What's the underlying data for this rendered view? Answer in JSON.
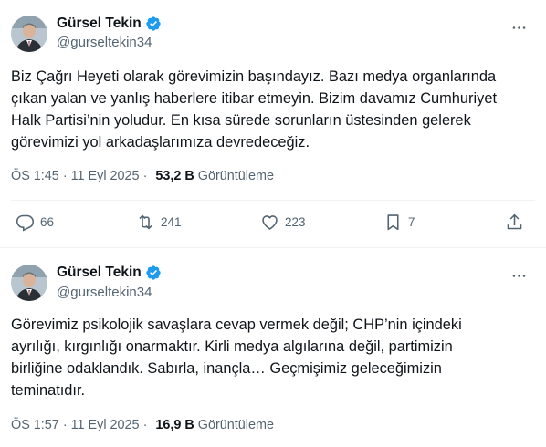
{
  "tweets": [
    {
      "author": {
        "name": "Gürsel Tekin",
        "handle": "@gurseltekin34"
      },
      "text": "Biz Çağrı Heyeti olarak görevimizin başındayız. Bazı medya organlarında\nçıkan yalan ve yanlış haberlere itibar etmeyin. Bizim davamız Cumhuriyet\nHalk Partisi’nin yoludur. En kısa sürede sorunların üstesinden gelerek\ngörevimizi yol arkadaşlarımıza devredeceğiz.",
      "time": "ÖS 1:45",
      "date": "11 Eyl 2025",
      "views_count": "53,2 B",
      "views_label": "Görüntüleme",
      "actions": {
        "replies": "66",
        "reposts": "241",
        "likes": "223",
        "bookmarks": "7"
      }
    },
    {
      "author": {
        "name": "Gürsel Tekin",
        "handle": "@gurseltekin34"
      },
      "text": "Görevimiz psikolojik savaşlara cevap vermek değil; CHP’nin içindeki\nayrılığı, kırgınlığı onarmaktır. Kirli medya algılarına değil, partimizin\nbirliğine odaklandık. Sabırla, inançla… Geçmişimiz geleceğimizin\nteminatıdır.",
      "time": "ÖS 1:57",
      "date": "11 Eyl 2025",
      "views_count": "16,9 B",
      "views_label": "Görüntüleme"
    }
  ],
  "colors": {
    "verified": "#1d9bf0",
    "secondary_text": "#536471",
    "primary_text": "#0f1419"
  },
  "icons": [
    "verified-badge-icon",
    "more-icon",
    "reply-icon",
    "repost-icon",
    "like-icon",
    "bookmark-icon",
    "share-icon"
  ]
}
